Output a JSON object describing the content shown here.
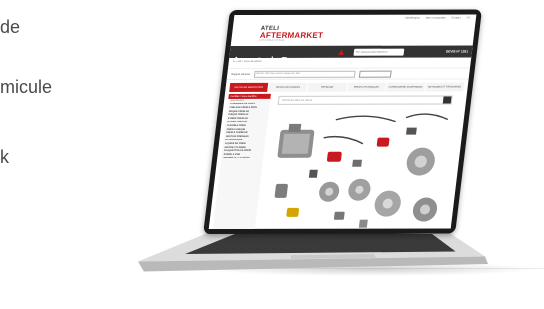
{
  "left_text": [
    "de",
    "micule",
    "k"
  ],
  "site": {
    "topbar_links": [
      "Identification",
      "Mes commandes",
      "Contact",
      "FR"
    ],
    "logo_top": "ATELI",
    "logo_main": "AFTERMARKET",
    "logo_sub": "INTERNATIONAL",
    "search_placeholder": "Par équipementier/référence",
    "quote_label": "DEVIS N°",
    "quote_number": "1351",
    "breadcrumb": "Accueil > Vente de pièces",
    "request_label": "Rapport véhicule",
    "request_text": "Réf/carte VIN/n°/type variante / équipement, KBA",
    "tabs": [
      "EN COURS REPARATION",
      "PIECES DETACHEES",
      "FREINAGE",
      "PIECES TECHNIQUES",
      "CARROSSERIE SUSPENSION",
      "METHODES ET PERSONNES"
    ],
    "sidebar_header": "Familles / Sous-Familles",
    "sidebar_group": "Sous-familles",
    "sidebar_items": [
      "COMMANDE DE FREIN",
      "CABLAGE FREIN A MAIN",
      "DISQUE FREIN AR",
      "DISQUE FREIN AV",
      "ETRIER FREIN AR",
      "ETRIER FREIN AV",
      "FLEXIBLE FREIN",
      "FREIN A DISQUE",
      "FREIN A TAMBOUR",
      "GESTION FREINAGE",
      "HYDRAULIQUE",
      "LIQUIDE DE FREIN",
      "MAITRE-CYLINDRE",
      "PLAQUETTES DE FREIN",
      "POMPE A VIDE",
      "SEGMENTS / CYLINDRE"
    ],
    "catalog_search_placeholder": "Recherche dans les pièces"
  },
  "colors": {
    "brand": "#c8191e",
    "dark": "#333333"
  }
}
